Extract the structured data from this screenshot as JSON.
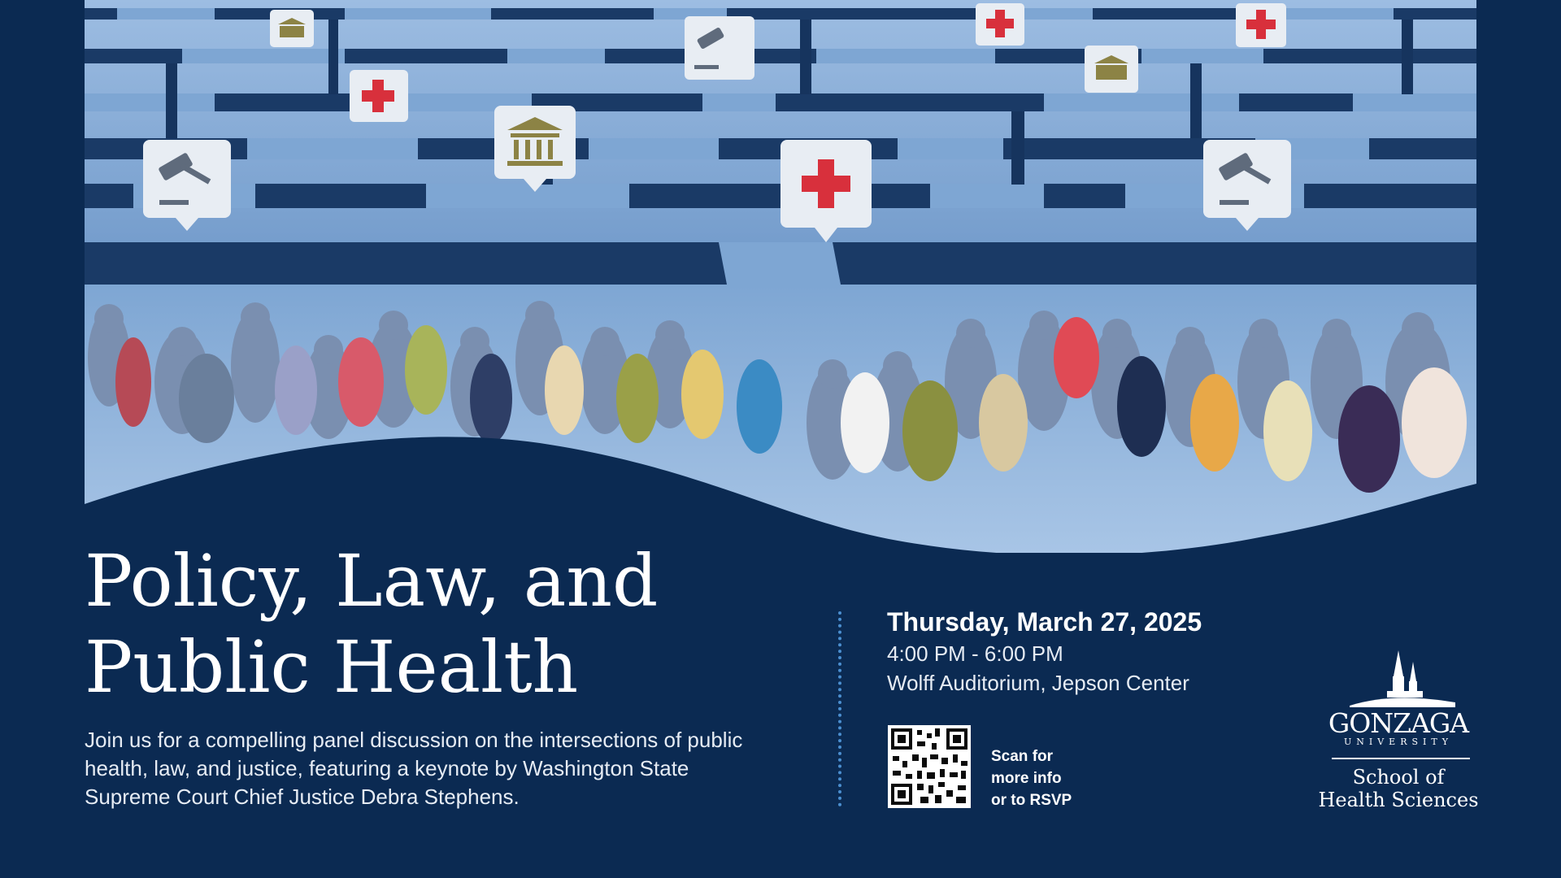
{
  "event": {
    "title_line1": "Policy, Law, and",
    "title_line2": "Public Health",
    "description": "Join us for a compelling panel discussion on the intersections of public health, law, and justice, featuring a keynote by Washington State Supreme Court Chief Justice Debra Stephens.",
    "date": "Thursday, March 27, 2025",
    "time": "4:00 PM - 6:00 PM",
    "location": "Wolff Auditorium, Jepson Center"
  },
  "rsvp": {
    "line1": "Scan for",
    "line2": "more info",
    "line3": "or to RSVP"
  },
  "logo": {
    "name": "GONZAGA",
    "subname": "UNIVERSITY",
    "school_line1": "School of",
    "school_line2": "Health Sciences"
  },
  "colors": {
    "background": "#0b2a52",
    "maze_light": "#8fb3db",
    "maze_dark": "#1a3a66",
    "cross_red": "#d8303c",
    "accent_dots": "#4b8fd0"
  },
  "icons": [
    "gavel-icon",
    "bank-icon",
    "medical-cross-icon",
    "qr-code-icon",
    "chapel-spires-icon"
  ]
}
